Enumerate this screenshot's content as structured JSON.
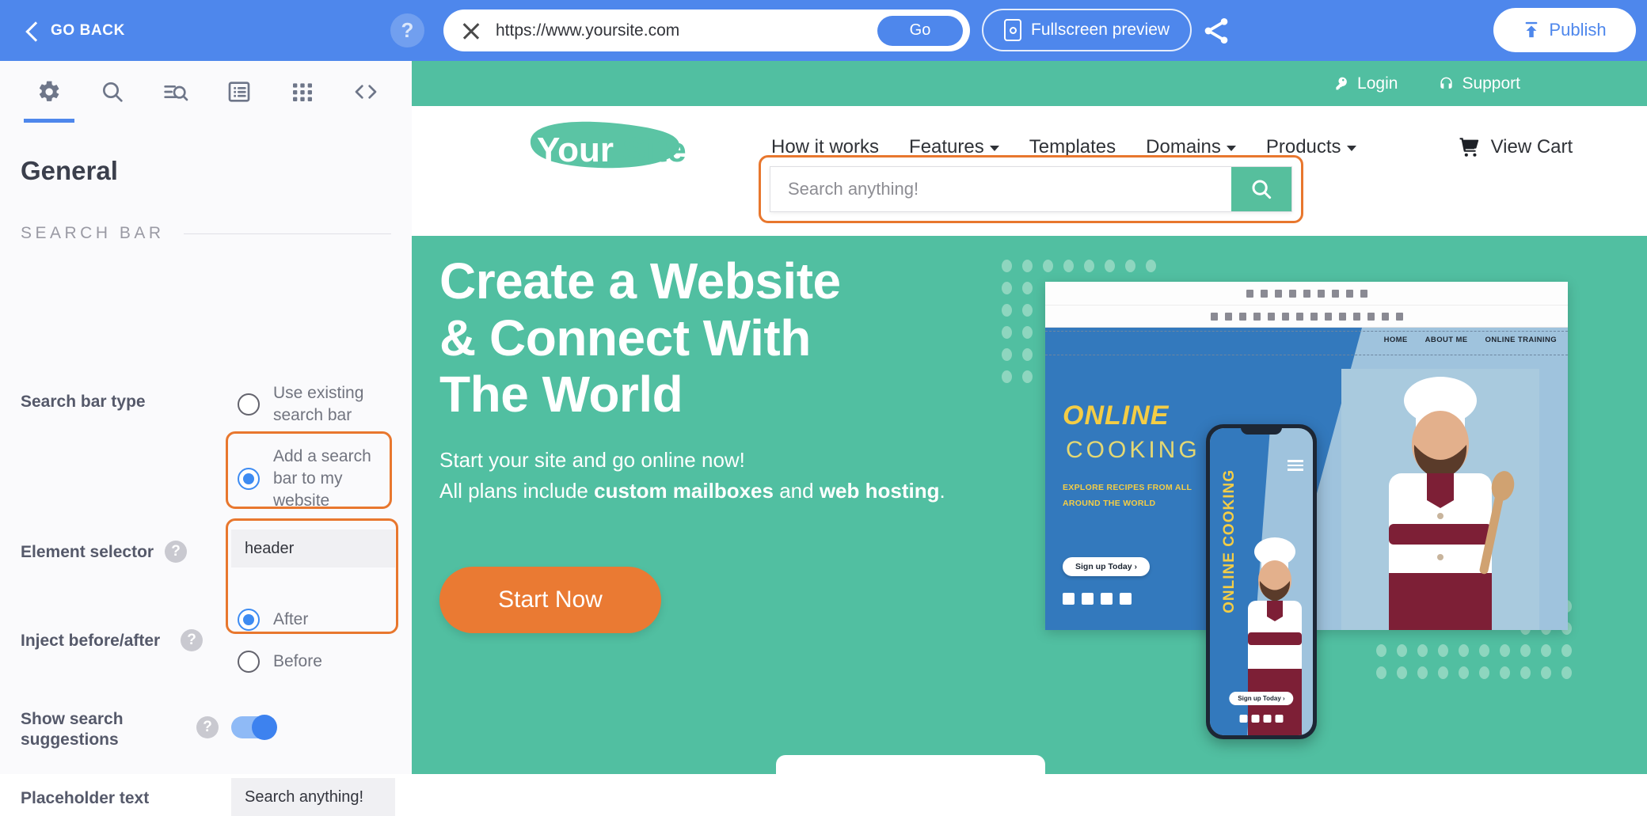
{
  "topbar": {
    "go_back_label": "GO BACK",
    "help_label": "?",
    "url_value": "https://www.yoursite.com",
    "go_label": "Go",
    "fullscreen_label": "Fullscreen preview",
    "publish_label": "Publish",
    "icons": {
      "back": "chevron-left-icon",
      "help": "help-icon",
      "clear": "close-icon",
      "fullscreen": "fullscreen-preview-icon",
      "share": "share-icon",
      "publish": "upload-icon"
    },
    "colors": {
      "bar": "#4e87ec",
      "accent": "#4e87ec"
    }
  },
  "left_panel": {
    "tabs": [
      {
        "name": "gear-icon",
        "label": "Settings",
        "active": true
      },
      {
        "name": "search-icon",
        "label": "Search",
        "active": false
      },
      {
        "name": "search-results-icon",
        "label": "Search results",
        "active": false
      },
      {
        "name": "list-icon",
        "label": "List",
        "active": false
      },
      {
        "name": "grid-icon",
        "label": "Grid",
        "active": false
      },
      {
        "name": "code-icon",
        "label": "Code",
        "active": false
      }
    ],
    "title": "General",
    "section_label": "SEARCH BAR",
    "fields": {
      "search_bar_type": {
        "label": "Search bar type",
        "options": [
          {
            "label": "Use existing search bar",
            "selected": false
          },
          {
            "label": "Add a search bar to my website",
            "selected": true
          }
        ]
      },
      "element_selector": {
        "label": "Element selector",
        "help": "?",
        "value": "header"
      },
      "inject": {
        "label": "Inject before/after",
        "help": "?",
        "options": [
          {
            "label": "After",
            "selected": true
          },
          {
            "label": "Before",
            "selected": false
          }
        ]
      },
      "show_suggestions": {
        "label": "Show search suggestions",
        "help": "?",
        "state": "on"
      },
      "placeholder_text": {
        "label": "Placeholder text",
        "value": "Search anything!"
      }
    },
    "highlight_color": "#e8772e"
  },
  "preview": {
    "utility_bar": {
      "login": "Login",
      "support": "Support"
    },
    "brand": {
      "part1": "Your",
      "part2": "Site"
    },
    "nav": [
      {
        "label": "How it works",
        "caret": false
      },
      {
        "label": "Features",
        "caret": true
      },
      {
        "label": "Templates",
        "caret": false
      },
      {
        "label": "Domains",
        "caret": true
      },
      {
        "label": "Products",
        "caret": true
      }
    ],
    "cart_label": "View Cart",
    "search": {
      "placeholder": "Search anything!",
      "button_icon": "search-icon",
      "highlighted": true
    },
    "hero": {
      "title_line1": "Create a Website",
      "title_line2": "& Connect With",
      "title_line3": "The World",
      "sub1": "Start your site and go online now!",
      "sub2_a": "All plans include ",
      "sub2_b": "custom mailboxes",
      "sub2_c": " and ",
      "sub2_d": "web hosting",
      "sub2_e": ".",
      "cta_label": "Start Now"
    },
    "illustration": {
      "browser_nav": [
        "HOME",
        "ABOUT ME",
        "ONLINE TRAINING"
      ],
      "headline1": "ONLINE",
      "headline2": "COOKING",
      "tagline1": "EXPLORE RECIPES FROM ALL",
      "tagline2": "AROUND THE WORLD",
      "cta": "Sign up Today ›",
      "phone_vertical_text": "ONLINE COOKING",
      "phone_cta": "Sign up Today ›"
    },
    "colors": {
      "brand_green": "#51bfa1",
      "cta_orange": "#ea7a33",
      "browser_blue": "#3379bd",
      "accent_yellow": "#f4cd45"
    }
  }
}
